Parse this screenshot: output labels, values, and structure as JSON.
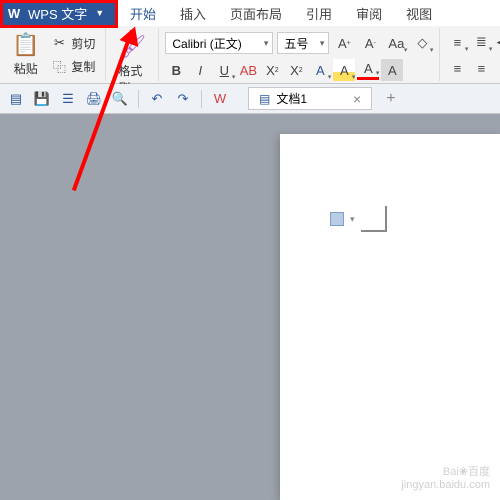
{
  "title": {
    "app_name": "WPS 文字"
  },
  "tabs": {
    "t0": "开始",
    "t1": "插入",
    "t2": "页面布局",
    "t3": "引用",
    "t4": "审阅",
    "t5": "视图"
  },
  "clipboard": {
    "paste": "粘贴",
    "cut": "剪切",
    "copy": "复制",
    "brush": "格式刷"
  },
  "font": {
    "name": "Calibri (正文)",
    "size": "五号"
  },
  "doc": {
    "tab_name": "文档1"
  },
  "watermark": {
    "l1": "Bai❀百度",
    "l2": "jingyan.baidu.com"
  }
}
